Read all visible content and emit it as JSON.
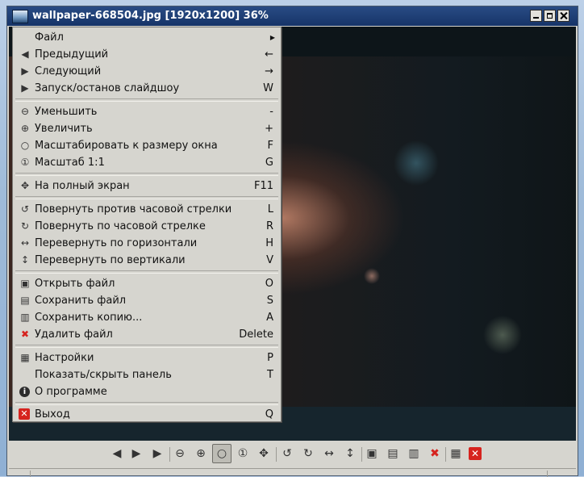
{
  "window": {
    "title": "wallpaper-668504.jpg [1920x1200] 36%"
  },
  "menu": {
    "items": [
      {
        "label": "Файл",
        "shortcut": "",
        "submenu": true,
        "icon": "none"
      },
      {
        "label": "Предыдущий",
        "shortcut": "←",
        "icon": "arrow-left-icon"
      },
      {
        "label": "Следующий",
        "shortcut": "→",
        "icon": "arrow-right-icon"
      },
      {
        "label": "Запуск/останов слайдшоу",
        "shortcut": "W",
        "icon": "play-icon"
      },
      {
        "label": "Уменьшить",
        "shortcut": "-",
        "icon": "zoom-out-icon"
      },
      {
        "label": "Увеличить",
        "shortcut": "+",
        "icon": "zoom-in-icon"
      },
      {
        "label": "Масштабировать к размеру окна",
        "shortcut": "F",
        "icon": "zoom-fit-icon"
      },
      {
        "label": "Масштаб 1:1",
        "shortcut": "G",
        "icon": "zoom-original-icon"
      },
      {
        "label": "На полный экран",
        "shortcut": "F11",
        "icon": "fullscreen-icon"
      },
      {
        "label": "Повернуть против часовой стрелки",
        "shortcut": "L",
        "icon": "rotate-ccw-icon"
      },
      {
        "label": "Повернуть по часовой стрелке",
        "shortcut": "R",
        "icon": "rotate-cw-icon"
      },
      {
        "label": "Перевернуть по горизонтали",
        "shortcut": "H",
        "icon": "flip-horizontal-icon"
      },
      {
        "label": "Перевернуть по вертикали",
        "shortcut": "V",
        "icon": "flip-vertical-icon"
      },
      {
        "label": "Открыть файл",
        "shortcut": "O",
        "icon": "open-file-icon"
      },
      {
        "label": "Сохранить файл",
        "shortcut": "S",
        "icon": "save-file-icon"
      },
      {
        "label": "Сохранить копию...",
        "shortcut": "A",
        "icon": "save-copy-icon"
      },
      {
        "label": "Удалить файл",
        "shortcut": "Delete",
        "icon": "delete-icon"
      },
      {
        "label": "Настройки",
        "shortcut": "P",
        "icon": "preferences-icon"
      },
      {
        "label": "Показать/скрыть панель",
        "shortcut": "T",
        "icon": "none"
      },
      {
        "label": "О программе",
        "shortcut": "",
        "icon": "info-icon"
      },
      {
        "label": "Выход",
        "shortcut": "Q",
        "icon": "quit-icon"
      }
    ]
  },
  "toolbar": {
    "buttons": [
      "arrow-left-icon",
      "arrow-right-icon",
      "play-icon",
      "zoom-out-icon",
      "zoom-in-icon",
      "zoom-fit-icon",
      "zoom-original-icon",
      "fullscreen-icon",
      "rotate-ccw-icon",
      "rotate-cw-icon",
      "flip-horizontal-icon",
      "flip-vertical-icon",
      "open-file-icon",
      "save-file-icon",
      "save-copy-icon",
      "delete-icon",
      "preferences-icon",
      "quit-icon"
    ],
    "active": "zoom-fit-icon"
  },
  "colors": {
    "titlebar": "#163468",
    "accent_red": "#d6231e",
    "menu_bg": "#d6d5cf"
  }
}
